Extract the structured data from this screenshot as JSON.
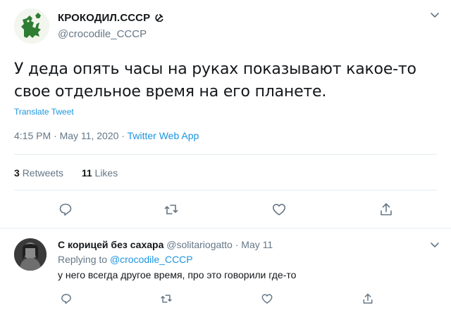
{
  "tweet": {
    "author": {
      "display_name": "КРОКОДИЛ.СССР",
      "emblem_icon": "hammer-sickle-icon",
      "handle": "@crocodile_CCCP"
    },
    "text_line1": "У деда опять часы на руках показывают какое-то",
    "text_line2": "свое отдельное время на его планете.",
    "translate_label": "Translate Tweet",
    "time": "4:15 PM",
    "date": "May 11, 2020",
    "dot": "·",
    "source": "Twitter Web App",
    "retweets_count": "3",
    "retweets_label": "Retweets",
    "likes_count": "11",
    "likes_label": "Likes",
    "actions": [
      "reply-icon",
      "retweet-icon",
      "like-icon",
      "share-icon"
    ]
  },
  "reply": {
    "display_name": "С корицей без сахара",
    "handle": "@solitariogatto",
    "dot": "·",
    "date": "May 11",
    "replying_to_label": "Replying to",
    "replying_to_handle": "@crocodile_CCCP",
    "text": "у него всегда другое время, про это говорили где-то"
  },
  "colors": {
    "text": "#14171a",
    "muted": "#657786",
    "link": "#1b95e0",
    "divider": "#e6ecf0",
    "logo_green": "#2e7d32"
  }
}
